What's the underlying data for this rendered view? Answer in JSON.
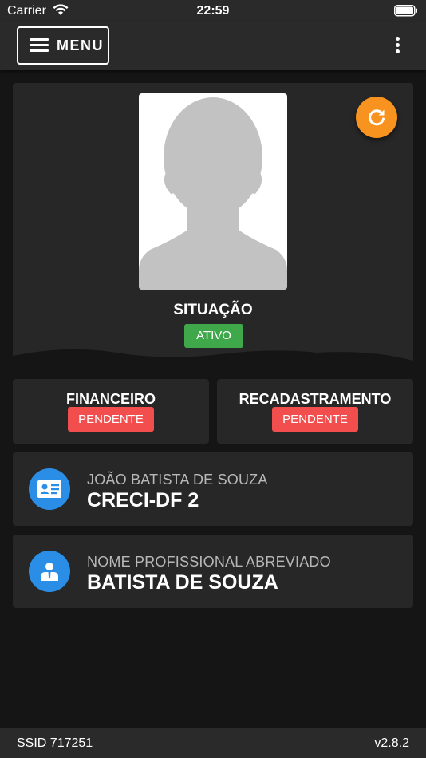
{
  "status_bar": {
    "carrier": "Carrier",
    "time": "22:59"
  },
  "header": {
    "menu_label": "MENU",
    "menu_icon": "hamburger-icon",
    "more_icon": "more-vertical-icon"
  },
  "profile": {
    "photo_icon": "avatar-placeholder-icon",
    "refresh_icon": "refresh-icon",
    "situacao_label": "SITUAÇÃO",
    "situacao_status": "ATIVO"
  },
  "status_cards": [
    {
      "title": "FINANCEIRO",
      "status": "PENDENTE"
    },
    {
      "title": "RECADASTRAMENTO",
      "status": "PENDENTE"
    }
  ],
  "info_cards": [
    {
      "icon": "id-card-icon",
      "label": "JOÃO BATISTA DE SOUZA",
      "value": "CRECI-DF 2"
    },
    {
      "icon": "person-icon",
      "label": "NOME PROFISSIONAL ABREVIADO",
      "value": "BATISTA DE SOUZA"
    }
  ],
  "footer": {
    "ssid": "SSID 717251",
    "version": "v2.8.2"
  },
  "colors": {
    "background": "#151515",
    "card": "#272727",
    "bar": "#2a2a2a",
    "accent_orange": "#f7931e",
    "status_green": "#3ea84a",
    "status_red": "#f24e4e",
    "icon_blue": "#2b8ee6"
  }
}
